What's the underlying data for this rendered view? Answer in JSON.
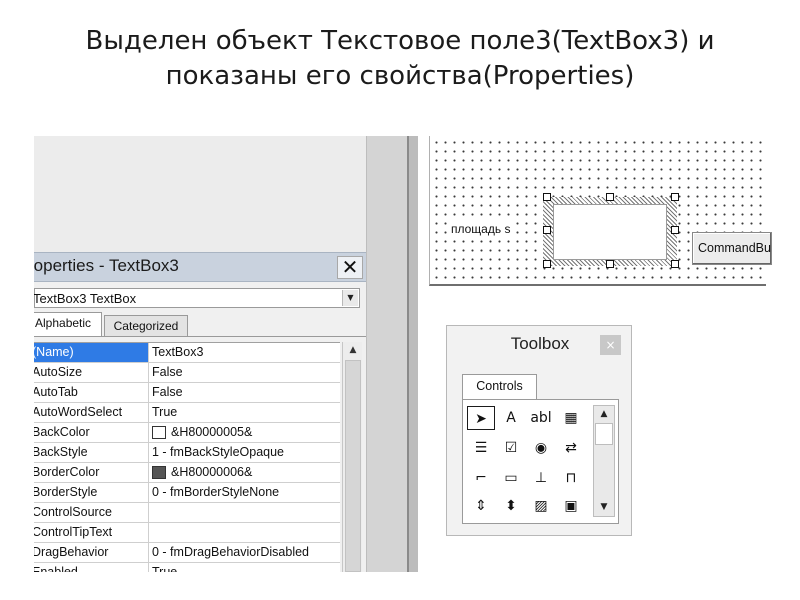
{
  "slide": {
    "title_line1": "Выделен объект Текстовое поле3(TextBox3) и",
    "title_line2": "показаны его свойства(Properties)"
  },
  "properties_window": {
    "title": "roperties - TextBox3",
    "close_glyph": "✕",
    "object_combo": "TextBox3 TextBox",
    "combo_arrow": "▼",
    "tabs": [
      "Alphabetic",
      "Categorized"
    ],
    "scroll_up": "▲",
    "rows": [
      {
        "name": "(Name)",
        "value": "TextBox3",
        "selected": true
      },
      {
        "name": "AutoSize",
        "value": "False"
      },
      {
        "name": "AutoTab",
        "value": "False"
      },
      {
        "name": "AutoWordSelect",
        "value": "True"
      },
      {
        "name": "BackColor",
        "value": "&H80000005&",
        "swatch": "#ffffff"
      },
      {
        "name": "BackStyle",
        "value": "1 - fmBackStyleOpaque"
      },
      {
        "name": "BorderColor",
        "value": "&H80000006&",
        "swatch": "#555555"
      },
      {
        "name": "BorderStyle",
        "value": "0 - fmBorderStyleNone"
      },
      {
        "name": "ControlSource",
        "value": ""
      },
      {
        "name": "ControlTipText",
        "value": ""
      },
      {
        "name": "DragBehavior",
        "value": "0 - fmDragBehaviorDisabled"
      },
      {
        "name": "Enabled",
        "value": "True"
      }
    ]
  },
  "form": {
    "label": "площадь s",
    "command_button": "CommandButton"
  },
  "toolbox": {
    "title": "Toolbox",
    "close_glyph": "×",
    "tab": "Controls",
    "tools": [
      {
        "glyph": "➤",
        "icon": "select-pointer-icon"
      },
      {
        "glyph": "A",
        "icon": "label-tool-icon"
      },
      {
        "glyph": "abl",
        "icon": "textbox-tool-icon"
      },
      {
        "glyph": "▦",
        "icon": "combobox-tool-icon"
      },
      {
        "glyph": "☰",
        "icon": "listbox-tool-icon"
      },
      {
        "glyph": "☑",
        "icon": "checkbox-tool-icon"
      },
      {
        "glyph": "◉",
        "icon": "optionbutton-tool-icon"
      },
      {
        "glyph": "⇄",
        "icon": "togglebutton-tool-icon"
      },
      {
        "glyph": "⌐",
        "icon": "frame-tool-icon"
      },
      {
        "glyph": "▭",
        "icon": "commandbutton-tool-icon"
      },
      {
        "glyph": "⊥",
        "icon": "tabstrip-tool-icon"
      },
      {
        "glyph": "⊓",
        "icon": "multipage-tool-icon"
      },
      {
        "glyph": "⇕",
        "icon": "scrollbar-tool-icon"
      },
      {
        "glyph": "⬍",
        "icon": "spinbutton-tool-icon"
      },
      {
        "glyph": "▨",
        "icon": "image-tool-icon"
      },
      {
        "glyph": "▣",
        "icon": "refedit-tool-icon"
      }
    ],
    "scroll_up": "▲",
    "scroll_down": "▼"
  }
}
